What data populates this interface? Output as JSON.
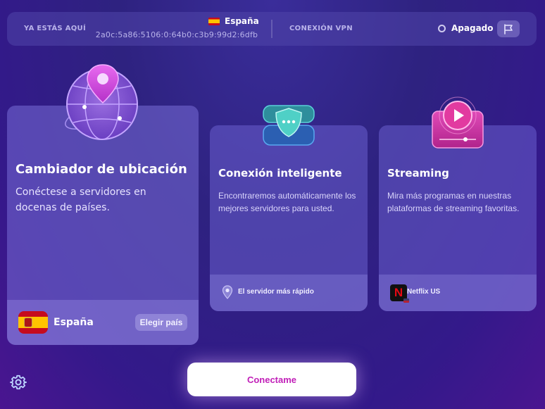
{
  "status_bar": {
    "location_label": "YA ESTÁS AQUÍ",
    "country": "España",
    "ip_address": "2a0c:5a86:5106:0:64b0:c3b9:99d2:6dfb",
    "vpn_label": "CONEXIÓN VPN",
    "vpn_status": "Apagado"
  },
  "cards": {
    "location_changer": {
      "title": "Cambiador de ubicación",
      "description": "Conéctese a servidores en docenas de países.",
      "selected_country": "España",
      "choose_button": "Elegir país"
    },
    "smart_connection": {
      "title": "Conexión inteligente",
      "description": "Encontraremos automáticamente los mejores servidores para usted.",
      "footer_label": "El servidor más rápido"
    },
    "streaming": {
      "title": "Streaming",
      "description": "Mira más programas en nuestras plataformas de streaming favoritas.",
      "footer_label": "Netflix US",
      "service_letter": "N"
    }
  },
  "connect_button": "Conectame",
  "icons": [
    "flag-icon",
    "globe-pin-icon",
    "shield-icon",
    "play-screen-icon",
    "location-pin-icon",
    "netflix-icon",
    "spain-flag-icon",
    "settings-gear-icon"
  ],
  "colors": {
    "accent": "#c11fb8",
    "spain_red": "#c60b1e",
    "spain_yellow": "#ffc400",
    "netflix_red": "#e50914"
  }
}
